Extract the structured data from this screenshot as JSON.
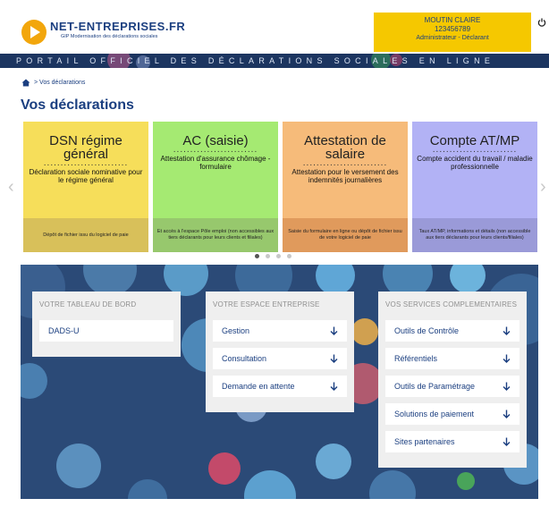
{
  "header": {
    "brand": "NET-ENTREPRISES.FR",
    "brand_sub": "GIP Modernisation des déclarations sociales",
    "user_name": "MOUTIN CLAIRE",
    "user_id": "123456789",
    "user_role": "Administrateur - Déclarant",
    "power_icon": "power-icon"
  },
  "portal": {
    "text": "PORTAIL OFFICIEL DES DÉCLARATIONS SOCIALES EN LIGNE"
  },
  "breadcrumb": {
    "home_icon": "home-icon",
    "label": "> Vos déclarations"
  },
  "page_title": "Vos déclarations",
  "carousel": {
    "prev_label": "‹",
    "next_label": "›",
    "dots": ".........................",
    "cards": [
      {
        "title": "DSN régime général",
        "desc": "Déclaration sociale nominative pour le régime général",
        "footer": "Dépôt de fichier issu du logiciel de paie",
        "color_top": "#f6de5a",
        "color_bottom": "#d8c05a"
      },
      {
        "title": "AC (saisie)",
        "desc": "Attestation d'assurance chômage - formulaire",
        "footer": "Et accès à l'espace Pôle emploi (non accessibles aux tiers déclarants pour leurs clients et filiales)",
        "color_top": "#a5ea72",
        "color_bottom": "#97c86d"
      },
      {
        "title": "Attestation de salaire",
        "desc": "Attestation pour le versement des indemnités journalières",
        "footer": "Saisie du formulaire en ligne ou dépôt de fichier issu de votre logiciel de paie",
        "color_top": "#f6bb7a",
        "color_bottom": "#e09a5c"
      },
      {
        "title": "Compte AT/MP",
        "desc": "Compte accident du travail / maladie professionnelle",
        "footer": "Taux AT/MP, informations et détails (non accessible aux tiers déclarants pour leurs clients/filiales)",
        "color_top": "#b2b2f5",
        "color_bottom": "#9a9ad8"
      }
    ]
  },
  "panels": [
    {
      "title": "VOTRE TABLEAU DE BORD",
      "items": [
        {
          "label": "DADS-U"
        }
      ]
    },
    {
      "title": "VOTRE ESPACE ENTREPRISE",
      "items": [
        {
          "label": "Gestion"
        },
        {
          "label": "Consultation"
        },
        {
          "label": "Demande en attente"
        }
      ]
    },
    {
      "title": "VOS SERVICES COMPLEMENTAIRES",
      "items": [
        {
          "label": "Outils de Contrôle"
        },
        {
          "label": "Référentiels"
        },
        {
          "label": "Outils de Paramétrage"
        },
        {
          "label": "Solutions de paiement"
        },
        {
          "label": "Sites partenaires"
        }
      ]
    }
  ],
  "colors": {
    "navy": "#1c3560",
    "brand_blue": "#1b3f80",
    "user_yellow": "#f5c800",
    "logo_orange": "#f2a60c",
    "dash_bg": "#2b4a77"
  }
}
